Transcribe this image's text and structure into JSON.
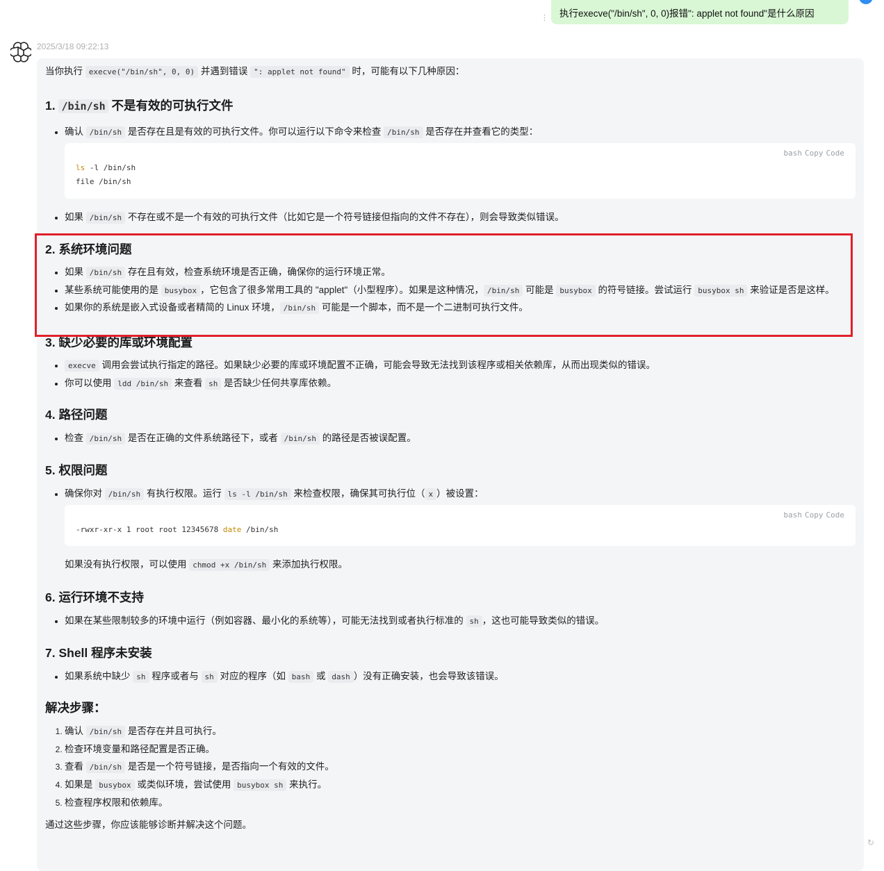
{
  "user_message": "执行execve(\"/bin/sh\", 0, 0)报错\": applet not found\"是什么原因",
  "timestamp": "2025/3/18 09:22:13",
  "intro": {
    "a": "当你执行 ",
    "c1": "execve(\"/bin/sh\", 0, 0)",
    "b": " 并遇到错误 ",
    "c2": "\": applet not found\"",
    "d": " 时，可能有以下几种原因："
  },
  "code_toolbar": {
    "lang": "bash",
    "copy": "Copy",
    "code": "Code"
  },
  "s1": {
    "num": "1. ",
    "code": "/bin/sh",
    "title": " 不是有效的可执行文件",
    "li1": {
      "a": "确认 ",
      "c1": "/bin/sh",
      "b": " 是否存在且是有效的可执行文件。你可以运行以下命令来检查 ",
      "c2": "/bin/sh",
      "d": " 是否存在并查看它的类型："
    },
    "code_l1_kw": "ls",
    "code_l1_rest": " -l /bin/sh",
    "code_l2": "file /bin/sh",
    "li2": {
      "a": "如果 ",
      "c1": "/bin/sh",
      "b": " 不存在或不是一个有效的可执行文件（比如它是一个符号链接但指向的文件不存在），则会导致类似错误。"
    }
  },
  "s2": {
    "title": "2. 系统环境问题",
    "li1": {
      "a": "如果 ",
      "c1": "/bin/sh",
      "b": " 存在且有效，检查系统环境是否正确，确保你的运行环境正常。"
    },
    "li2": {
      "a": "某些系统可能使用的是 ",
      "c1": "busybox",
      "b": "，它包含了很多常用工具的 \"applet\"（小型程序）。如果是这种情况，",
      "c2": "/bin/sh",
      "d": " 可能是 ",
      "c3": "busybox",
      "e": " 的符号链接。尝试运行 ",
      "c4": "busybox sh",
      "f": " 来验证是否是这样。"
    },
    "li3": {
      "a": "如果你的系统是嵌入式设备或者精简的 Linux 环境，",
      "c1": "/bin/sh",
      "b": " 可能是一个脚本，而不是一个二进制可执行文件。"
    }
  },
  "s3": {
    "title": "3. 缺少必要的库或环境配置",
    "li1": {
      "c1": "execve",
      "b": " 调用会尝试执行指定的路径。如果缺少必要的库或环境配置不正确，可能会导致无法找到该程序或相关依赖库，从而出现类似的错误。"
    },
    "li2": {
      "a": "你可以使用 ",
      "c1": "ldd /bin/sh",
      "b": " 来查看 ",
      "c2": "sh",
      "d": " 是否缺少任何共享库依赖。"
    }
  },
  "s4": {
    "title": "4. 路径问题",
    "li1": {
      "a": "检查 ",
      "c1": "/bin/sh",
      "b": " 是否在正确的文件系统路径下，或者 ",
      "c2": "/bin/sh",
      "d": " 的路径是否被误配置。"
    }
  },
  "s5": {
    "title": "5. 权限问题",
    "li1": {
      "a": "确保你对 ",
      "c1": "/bin/sh",
      "b": " 有执行权限。运行 ",
      "c2": "ls -l /bin/sh",
      "d": " 来检查权限，确保其可执行位（",
      "c3": "x",
      "e": "）被设置："
    },
    "code_a": "-rwxr-xr-x 1 root root 12345678 ",
    "code_kw": "date",
    "code_b": " /bin/sh",
    "after": {
      "a": "如果没有执行权限，可以使用 ",
      "c1": "chmod +x /bin/sh",
      "b": " 来添加执行权限。"
    }
  },
  "s6": {
    "title": "6. 运行环境不支持",
    "li1": {
      "a": "如果在某些限制较多的环境中运行（例如容器、最小化的系统等），可能无法找到或者执行标准的 ",
      "c1": "sh",
      "b": "，这也可能导致类似的错误。"
    }
  },
  "s7": {
    "title": "7. Shell 程序未安装",
    "li1": {
      "a": "如果系统中缺少 ",
      "c1": "sh",
      "b": " 程序或者与 ",
      "c2": "sh",
      "d": " 对应的程序（如 ",
      "c3": "bash",
      "e": " 或 ",
      "c4": "dash",
      "f": "）没有正确安装，也会导致该错误。"
    }
  },
  "solution": {
    "title": "解决步骤：",
    "step1": {
      "a": "确认 ",
      "c1": "/bin/sh",
      "b": " 是否存在并且可执行。"
    },
    "step2": "检查环境变量和路径配置是否正确。",
    "step3": {
      "a": "查看 ",
      "c1": "/bin/sh",
      "b": " 是否是一个符号链接，是否指向一个有效的文件。"
    },
    "step4": {
      "a": "如果是 ",
      "c1": "busybox",
      "b": " 或类似环境，尝试使用 ",
      "c2": "busybox sh",
      "d": " 来执行。"
    },
    "step5": "检查程序权限和依赖库。"
  },
  "conclusion": "通过这些步骤，你应该能够诊断并解决这个问题。"
}
